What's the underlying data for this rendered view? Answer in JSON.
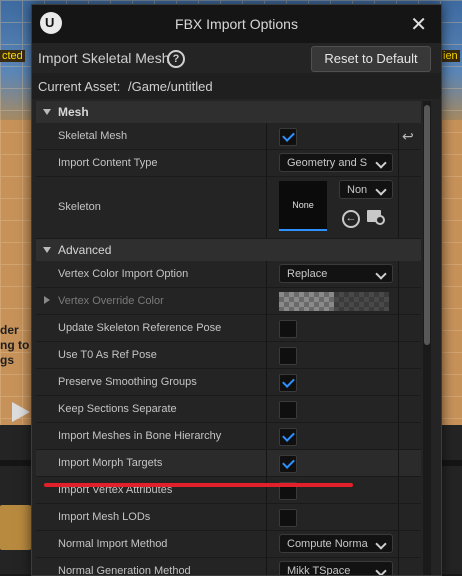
{
  "background": {
    "left_text_top": "cted",
    "right_text_top": "ien",
    "left_text_mid1": "der",
    "left_text_mid2": "ng to",
    "left_text_mid3": "gs"
  },
  "dialog": {
    "title": "FBX Import Options",
    "header_label": "Import Skeletal Mesh",
    "reset_label": "Reset to Default",
    "current_asset_label": "Current Asset:",
    "current_asset_value": "/Game/untitled"
  },
  "sections": {
    "mesh": "Mesh",
    "advanced": "Advanced"
  },
  "rows": {
    "skeletal_mesh": {
      "label": "Skeletal Mesh",
      "checked": true
    },
    "import_content_type": {
      "label": "Import Content Type",
      "value": "Geometry and S"
    },
    "skeleton": {
      "label": "Skeleton",
      "thumb": "None",
      "value": "Non"
    },
    "vertex_color_import": {
      "label": "Vertex Color Import Option",
      "value": "Replace"
    },
    "vertex_override_color": {
      "label": "Vertex Override Color"
    },
    "update_skeleton_ref": {
      "label": "Update Skeleton Reference Pose",
      "checked": false
    },
    "use_t0": {
      "label": "Use T0 As Ref Pose",
      "checked": false
    },
    "preserve_smoothing": {
      "label": "Preserve Smoothing Groups",
      "checked": true
    },
    "keep_sections": {
      "label": "Keep Sections Separate",
      "checked": false
    },
    "import_meshes_bone": {
      "label": "Import Meshes in Bone Hierarchy",
      "checked": true
    },
    "import_morph": {
      "label": "Import Morph Targets",
      "checked": true
    },
    "import_vertex_attr": {
      "label": "Import Vertex Attributes",
      "checked": false
    },
    "import_mesh_lods": {
      "label": "Import Mesh LODs",
      "checked": false
    },
    "normal_import": {
      "label": "Normal Import Method",
      "value": "Compute Norma"
    },
    "normal_generation": {
      "label": "Normal Generation Method",
      "value": "Mikk TSpace"
    }
  },
  "colors": {
    "accent": "#2f90ff",
    "annotation": "#e2202a"
  }
}
